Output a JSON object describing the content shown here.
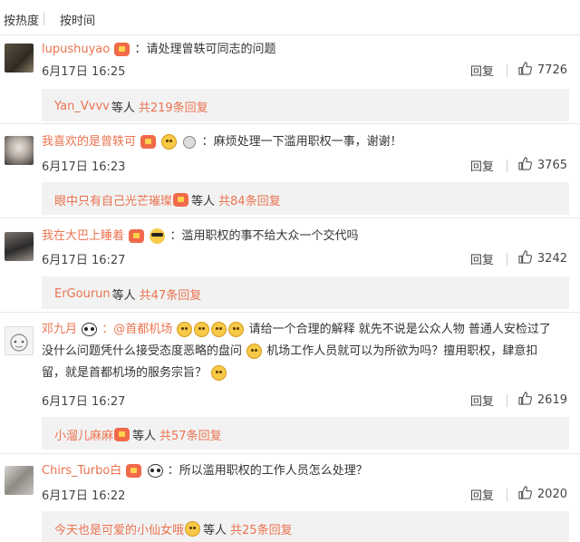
{
  "tabs": [
    "按热度",
    "按时间"
  ],
  "actions": {
    "reply_label": "回复"
  },
  "comments": [
    {
      "username": "lupushuyao",
      "text": "：请处理曾轶可同志的问题",
      "date": "6月17日 16:25",
      "likes": "7726",
      "reply_user": "Yan_Vvvv",
      "reply_etc": "等人",
      "reply_count": "共219条回复"
    },
    {
      "username": "我喜欢的是曾轶可",
      "text": "：麻烦处理一下滥用职权一事，谢谢！",
      "date": "6月17日 16:23",
      "likes": "3765",
      "reply_user": "眼中只有自己光芒璀璨",
      "reply_etc": "等人",
      "reply_count": "共84条回复"
    },
    {
      "username": "我在大巴上睡着",
      "text": "：滥用职权的事不给大众一个交代吗",
      "date": "6月17日 16:27",
      "likes": "3242",
      "reply_user": "ErGourun",
      "reply_etc": "等人",
      "reply_count": "共47条回复"
    },
    {
      "username": "邓九月",
      "mention": "：@首都机场",
      "text_a": "请给一个合理的解释 就先不说是公众人物 普通人安检过了",
      "text_b": "没什么问题凭什么接受态度恶略的盘问",
      "text_c": "机场工作人员就可以为所欲为吗？擅用职权，肆意扣",
      "text_d": "留，就是首都机场的服务宗旨？",
      "date": "6月17日 16:27",
      "likes": "2619",
      "reply_user": "小溜儿麻麻",
      "reply_etc": "等人",
      "reply_count": "共57条回复"
    },
    {
      "username": "Chirs_Turbo白",
      "text": "：所以滥用职权的工作人员怎么处理？",
      "date": "6月17日 16:22",
      "likes": "2020",
      "reply_user": "今天也是可爱的小仙女哦",
      "reply_etc": "等人",
      "reply_count": "共25条回复"
    }
  ]
}
